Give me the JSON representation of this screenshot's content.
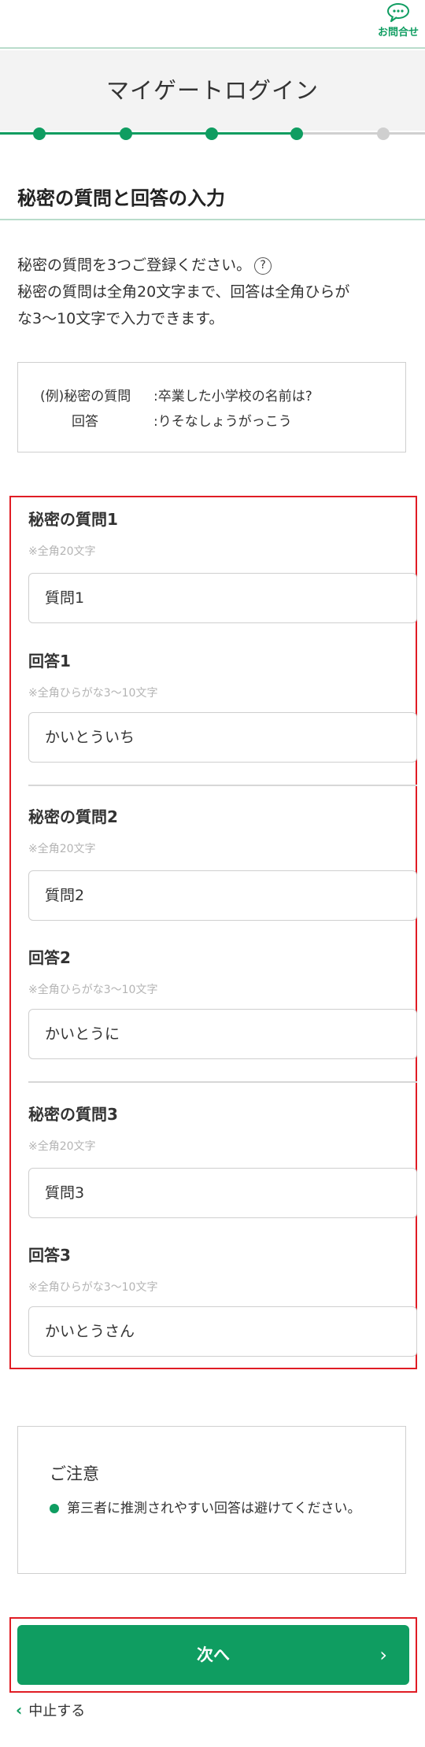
{
  "header": {
    "contact_label": "お問合せ",
    "contact_icon": "chat-bubble-icon"
  },
  "page_title": "マイゲートログイン",
  "progress": {
    "total_steps": 5,
    "current_step": 4,
    "color_active": "#0f9d61",
    "color_inactive": "#cfcfcf"
  },
  "section_title": "秘密の質問と回答の入力",
  "intro": {
    "line1": "秘密の質問を3つご登録ください。",
    "help_icon": "?",
    "line2": "秘密の質問は全角20文字まで、回答は全角ひらが",
    "line3": "な3〜10文字で入力できます。"
  },
  "example": {
    "q_key": "(例)秘密の質問",
    "q_value": ":卒業した小学校の名前は?",
    "a_key": "回答",
    "a_value": ":りそなしょうがっこう"
  },
  "questions": [
    {
      "q_label": "秘密の質問1",
      "q_note": "※全角20文字",
      "q_value": "質問1",
      "a_label": "回答1",
      "a_note": "※全角ひらがな3〜10文字",
      "a_value": "かいとういち"
    },
    {
      "q_label": "秘密の質問2",
      "q_note": "※全角20文字",
      "q_value": "質問2",
      "a_label": "回答2",
      "a_note": "※全角ひらがな3〜10文字",
      "a_value": "かいとうに"
    },
    {
      "q_label": "秘密の質問3",
      "q_note": "※全角20文字",
      "q_value": "質問3",
      "a_label": "回答3",
      "a_note": "※全角ひらがな3〜10文字",
      "a_value": "かいとうさん"
    }
  ],
  "notice": {
    "title": "ご注意",
    "text": "第三者に推測されやすい回答は避けてください。"
  },
  "next_button": {
    "label": "次へ",
    "chevron": "›"
  },
  "cancel_link": {
    "label": "中止する",
    "chevron": "‹"
  },
  "colors": {
    "brand_green": "#0f9d61",
    "highlight_red": "#e01c24"
  }
}
